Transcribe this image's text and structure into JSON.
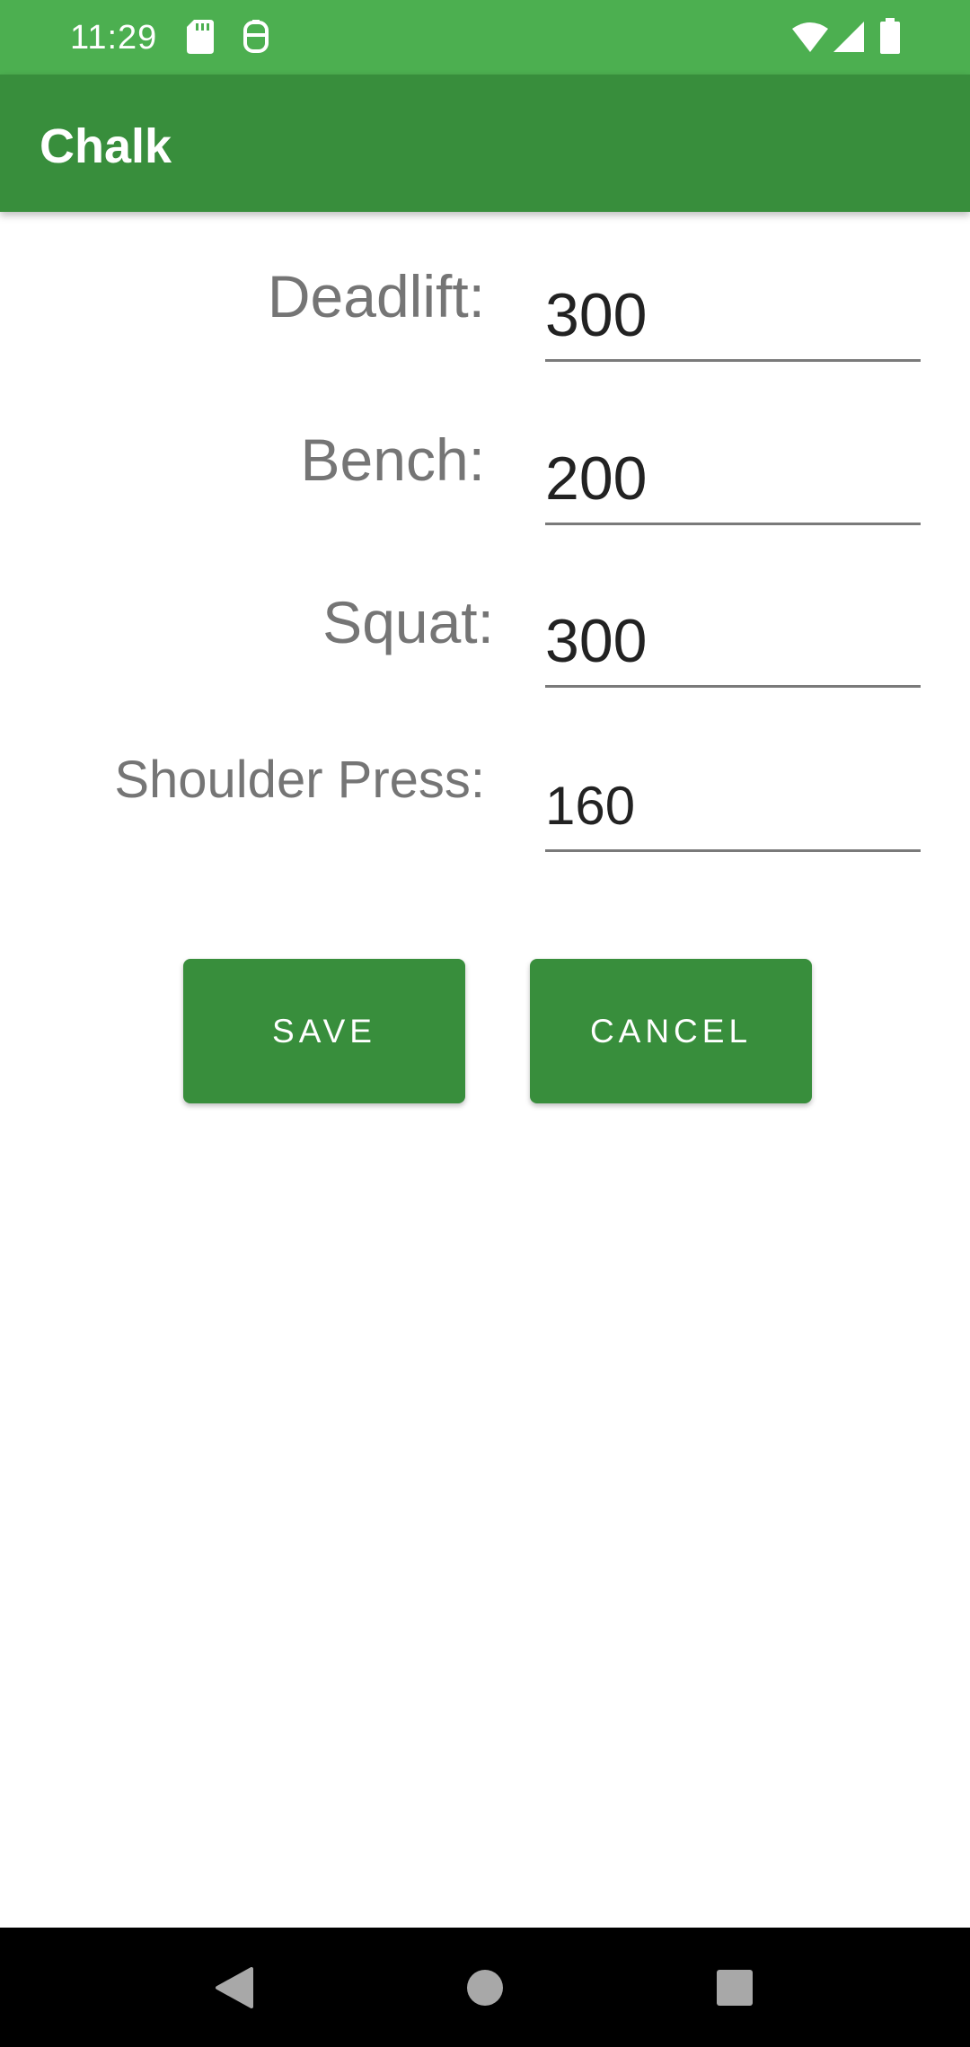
{
  "status_bar": {
    "time": "11:29",
    "icons": [
      "sd-card-icon",
      "debug-icon",
      "wifi-icon",
      "signal-icon",
      "battery-icon"
    ]
  },
  "app_bar": {
    "title": "Chalk",
    "color": "#388e3c"
  },
  "form": {
    "fields": [
      {
        "label": "Deadlift:",
        "value": "300"
      },
      {
        "label": "Bench:",
        "value": "200"
      },
      {
        "label": "Squat:",
        "value": "300"
      },
      {
        "label": "Shoulder Press:",
        "value": "160"
      }
    ]
  },
  "buttons": {
    "save_label": "SAVE",
    "cancel_label": "CANCEL"
  },
  "nav_bar": {
    "icons": [
      "back-icon",
      "home-icon",
      "recents-icon"
    ]
  },
  "colors": {
    "status_bar": "#4caf50",
    "primary": "#388e3c",
    "label_text": "#757575",
    "value_text": "#222222"
  }
}
